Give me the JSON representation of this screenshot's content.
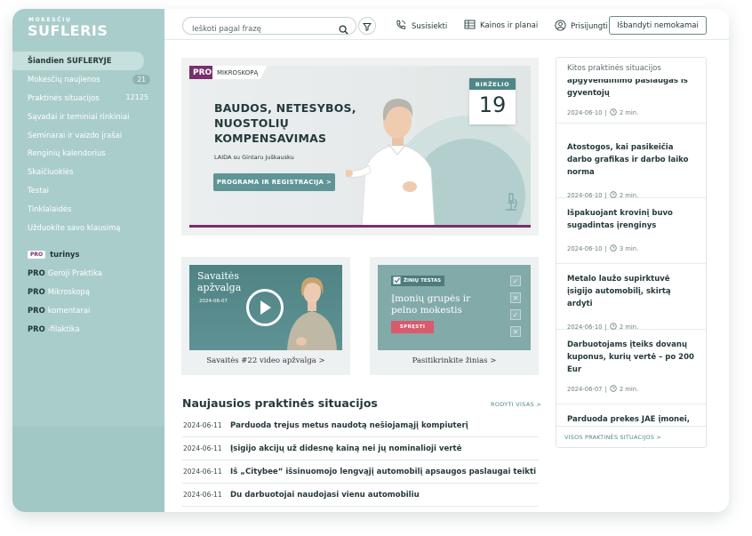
{
  "brand": {
    "small": "MOKESČIŲ",
    "big": "SUFLERIS"
  },
  "sidebar": {
    "items": [
      {
        "label": "Šiandien SUFLERYJE",
        "active": true
      },
      {
        "label": "Mokesčių naujienos",
        "badge": "21"
      },
      {
        "label": "Praktinės situacijos",
        "count": "12125"
      },
      {
        "label": "Sąvadai ir teminiai rinkiniai"
      },
      {
        "label": "Seminarai ir vaizdo įrašai"
      },
      {
        "label": "Renginių kalendorius"
      },
      {
        "label": "Skaičiuoklės"
      },
      {
        "label": "Testai"
      },
      {
        "label": "Tinklalaidės"
      },
      {
        "label": "Užduokite savo klausimą"
      }
    ],
    "pro_section": {
      "tag": "PRO",
      "head": "turinys",
      "items": [
        {
          "pro": "PRO",
          "label": "Geroji Praktika"
        },
        {
          "pro": "PRO",
          "label": "Mikroskopą"
        },
        {
          "pro": "PRO",
          "label": "komentarai"
        },
        {
          "pro": "PRO",
          "label": "-filaktika"
        }
      ]
    }
  },
  "topbar": {
    "search_placeholder": "Ieškoti pagal frazę",
    "contact": "Susisiekti",
    "pricing": "Kainos ir planai",
    "login": "Prisijungti",
    "try_free": "Išbandyti nemokamai"
  },
  "banner": {
    "pro": "PRO",
    "section": "MIKROSKOPĄ",
    "title": "BAUDOS, NETESYBOS, NUOSTOLIŲ KOMPENSAVIMAS",
    "subtitle": "LAIDA su Gintaru Juškausku",
    "button": "PROGRAMA IR REGISTRACIJA >",
    "month": "BIRŽELIO",
    "day": "19"
  },
  "video_card": {
    "title_line1": "Savaitės",
    "title_line2": "apžvalga",
    "date": "2024-06-07",
    "caption": "Savaitės #22 video apžvalga >"
  },
  "quiz_card": {
    "tag": "ŽINIŲ TESTAS",
    "title_line1": "Įmonių grupės ir",
    "title_line2": "pelno mokestis",
    "button": "SPRĘSTI",
    "caption": "Pasitikrinkite žinias >"
  },
  "latest": {
    "heading": "Naujausios praktinės situacijos",
    "more": "RODYTI VISAS >",
    "rows": [
      {
        "date": "2024-06-11",
        "title": "Parduoda trejus metus naudotą nešiojamąjį kompiuterį"
      },
      {
        "date": "2024-06-11",
        "title": "Įsigijo akcijų už didesnę kainą nei jų nominalioji vertė"
      },
      {
        "date": "2024-06-11",
        "title": "Iš „Citybee“ išsinuomojo lengvąjį automobilį apsaugos paslaugai teikti"
      },
      {
        "date": "2024-06-11",
        "title": "Du darbuotojai naudojasi vienu automobiliu"
      }
    ]
  },
  "side_panel": {
    "heading": "Kitos praktinės situacijos",
    "items": [
      {
        "title_partial": "apgyvendinimo paslaugas iš",
        "title_line": "gyventojų",
        "date": "2024-06-10",
        "read": "2 min."
      },
      {
        "title": "Atostogos, kai pasikeičia darbo grafikas ir darbo laiko norma",
        "date": "2024-06-10",
        "read": "2 min."
      },
      {
        "title": "Išpakuojant krovinį buvo sugadintas įrenginys",
        "date": "2024-06-10",
        "read": "3 min."
      },
      {
        "title": "Metalo laužo supirktuvė įsigijo automobilį, skirtą ardyti",
        "date": "2024-06-10",
        "read": "2 min."
      },
      {
        "title": "Darbuotojams įteiks dovanų kuponus, kurių vertė – po 200 Eur",
        "date": "2024-06-07",
        "read": "2 min."
      },
      {
        "title": "Parduoda prekes JAE įmonei,",
        "date": "",
        "read": ""
      }
    ],
    "footer": "VISOS PRAKTINĖS SITUACIJOS >"
  },
  "colors": {
    "sidebar": "#a9cdcb",
    "accent_purple": "#7b2d6e",
    "teal": "#5f9597",
    "quiz_red": "#d95a6d"
  }
}
